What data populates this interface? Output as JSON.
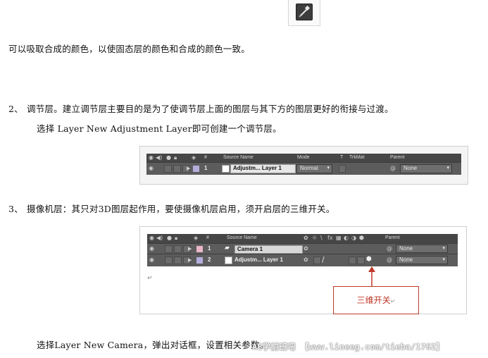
{
  "paragraphs": {
    "p1": "可以吸取合成的颜色，以使固态层的颜色和合成的颜色一致。",
    "p2_num": "2、",
    "p2": "调节层。建立调节层主要目的是为了使调节层上面的图层与其下方的图层更好的衔接与过渡。",
    "p3": "选择 Layer New Adjustment Layer即可创建一个调节层。",
    "p4_num": "3、",
    "p4": "摄像机层：其只对3D图层起作用，要使摄像机层启用，须开启层的三维开关。",
    "p5": "选择Layer New Camera，弹出对话框，设置相关参数。"
  },
  "panel1": {
    "headers": {
      "hash": "#",
      "source_name": "Source Name",
      "mode": "Mode",
      "t": "T",
      "trkmat": "TrkMat",
      "parent": "Parent"
    },
    "row": {
      "number": "1",
      "name": "Adjustm... Layer 1",
      "mode": "Normal",
      "parent": "None"
    }
  },
  "panel2": {
    "headers": {
      "hash": "#",
      "source_name": "Source Name",
      "parent": "Parent"
    },
    "rows": [
      {
        "number": "1",
        "name": "Camera 1",
        "parent": "None"
      },
      {
        "number": "2",
        "name": "Adjustm... Layer 1",
        "parent": "None"
      }
    ],
    "callout": "三维开关"
  },
  "watermark": "AE学前班吧 【www.lineeg.com/tieba/1762】",
  "colors": {
    "panel_bg": "#575757",
    "label_lavender": "#b3aedc",
    "label_pink": "#e9b6c6",
    "callout_red": "#c0392b"
  },
  "icons": [
    "eyedropper-icon",
    "eye-icon",
    "audio-icon",
    "solo-icon",
    "lock-icon",
    "label-tag-icon",
    "3d-switch-icon",
    "parent-spiral-icon",
    "camera-icon"
  ]
}
